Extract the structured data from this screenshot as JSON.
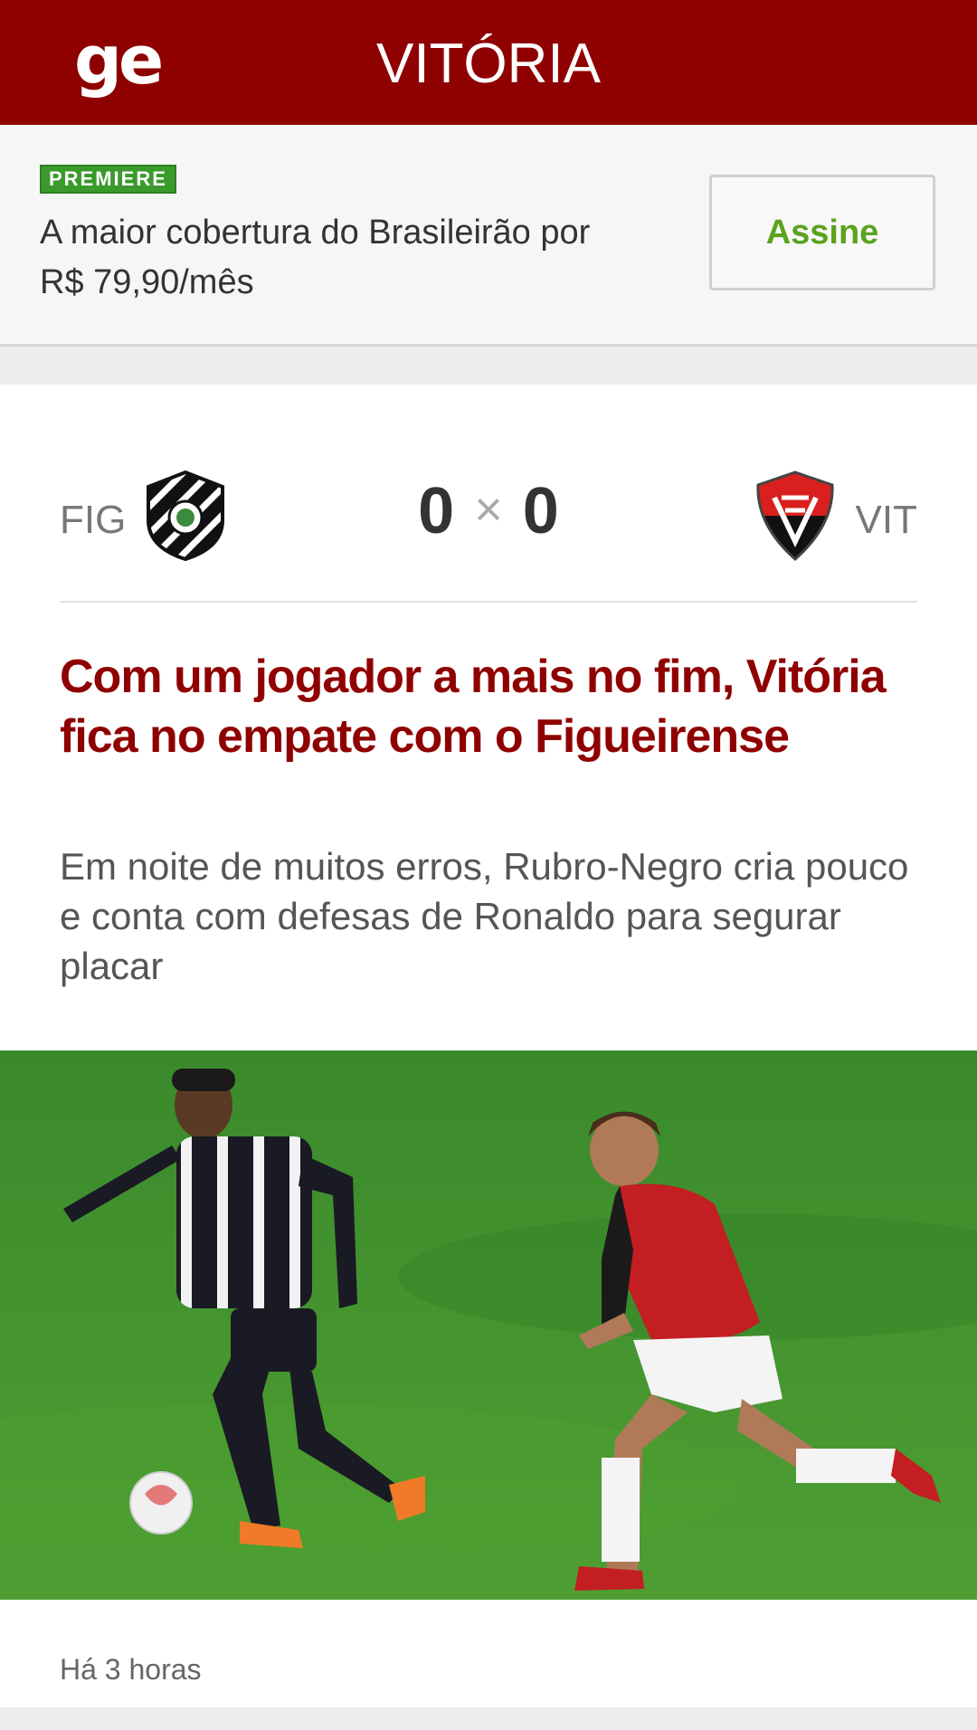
{
  "header": {
    "logo_text": "ge",
    "title": "VITÓRIA",
    "background": "#8f0000"
  },
  "promo": {
    "badge": "PREMIERE",
    "text": "A maior cobertura do Brasileirão por R$ 79,90/mês",
    "button_label": "Assine",
    "button_color": "#5aa31e"
  },
  "match": {
    "home_abbr": "FIG",
    "away_abbr": "VIT",
    "home_score": "0",
    "separator": "×",
    "away_score": "0",
    "home_crest_icon": "figueirense-crest-icon",
    "away_crest_icon": "vitoria-crest-icon"
  },
  "article": {
    "headline": "Com um jogador a mais no fim, Vitória fica no empate com o Figueirense",
    "subhead": "Em noite de muitos erros, Rubro-Negro cria pouco e conta com defesas de Ronaldo para segurar placar",
    "headline_color": "#8f0000",
    "timestamp": "Há 3 horas"
  }
}
